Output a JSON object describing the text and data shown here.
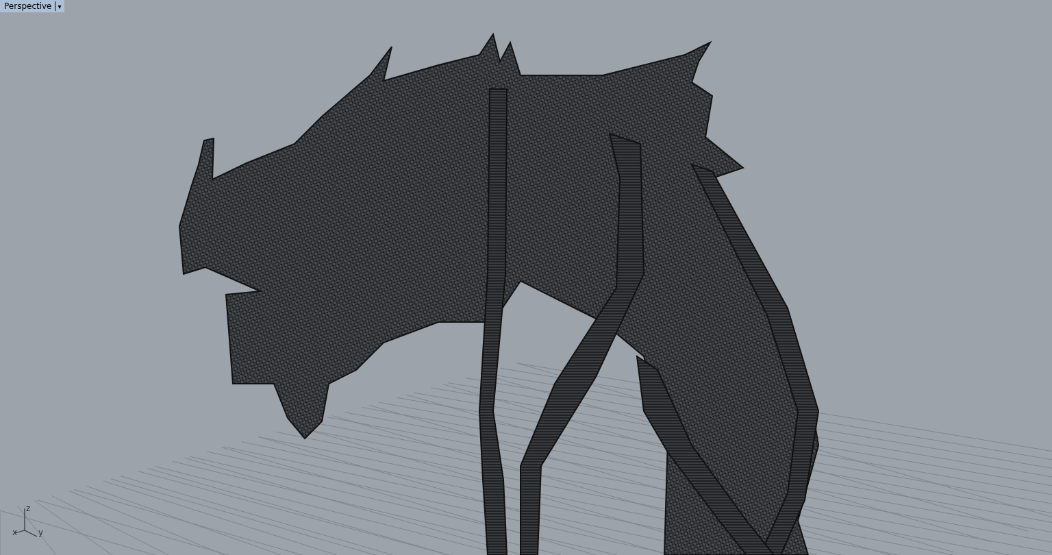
{
  "viewport": {
    "title": "Perspective",
    "menu_caret": "▾",
    "axes": {
      "x": "x",
      "y": "y",
      "z": "z"
    }
  }
}
